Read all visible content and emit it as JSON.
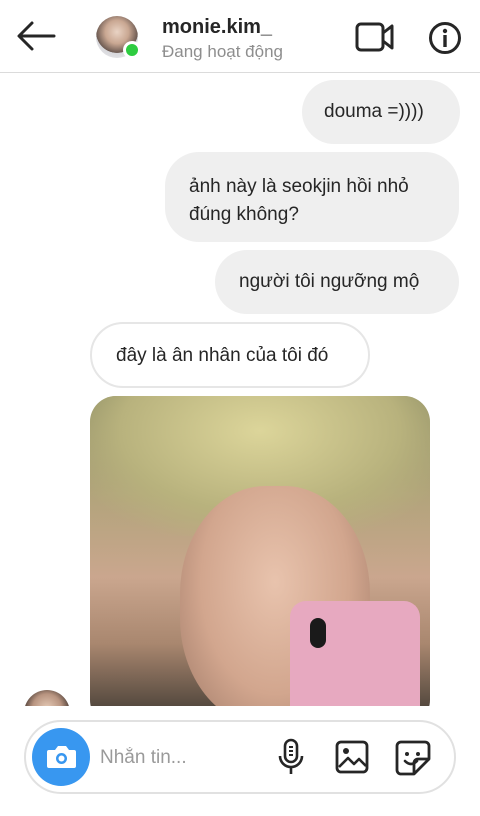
{
  "header": {
    "username": "monie.kim_",
    "status": "Đang hoạt động",
    "icons": {
      "back": "back-arrow-icon",
      "video": "video-call-icon",
      "info": "info-icon"
    },
    "online_color": "#2ecc40"
  },
  "messages": [
    {
      "direction": "sent",
      "text": "douma =))))"
    },
    {
      "direction": "sent",
      "text": "ảnh này là seokjin hồi nhỏ đúng không?"
    },
    {
      "direction": "sent",
      "text": "người tôi ngưỡng mộ"
    },
    {
      "direction": "received",
      "text": "đây là ân nhân của tôi đó"
    },
    {
      "direction": "received",
      "type": "photo"
    }
  ],
  "composer": {
    "placeholder": "Nhắn tin...",
    "icons": {
      "camera": "camera-icon",
      "mic": "microphone-icon",
      "gallery": "gallery-icon",
      "sticker": "sticker-icon"
    },
    "accent": "#3897f0"
  },
  "colors": {
    "sent_bubble": "#efefef",
    "received_border": "#e6e6e6",
    "text": "#262626",
    "muted": "#8e8e8e"
  }
}
